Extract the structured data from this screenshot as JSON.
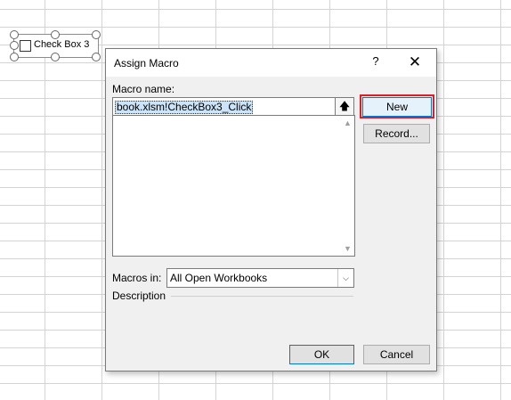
{
  "worksheet": {
    "checkbox_control_label": "Check Box 3"
  },
  "dialog": {
    "title": "Assign Macro",
    "help_glyph": "?",
    "close_glyph": "✕",
    "macro_name_label": "Macro name:",
    "macro_name_value": "book.xlsm!CheckBox3_Click",
    "macro_list_items": [],
    "macros_in_label": "Macros in:",
    "macros_in_value": "All Open Workbooks",
    "description_label": "Description",
    "buttons": {
      "new": "New",
      "record": "Record...",
      "ok": "OK",
      "cancel": "Cancel"
    },
    "highlight_color": "#d9202a",
    "accent_color": "#0078d7"
  }
}
